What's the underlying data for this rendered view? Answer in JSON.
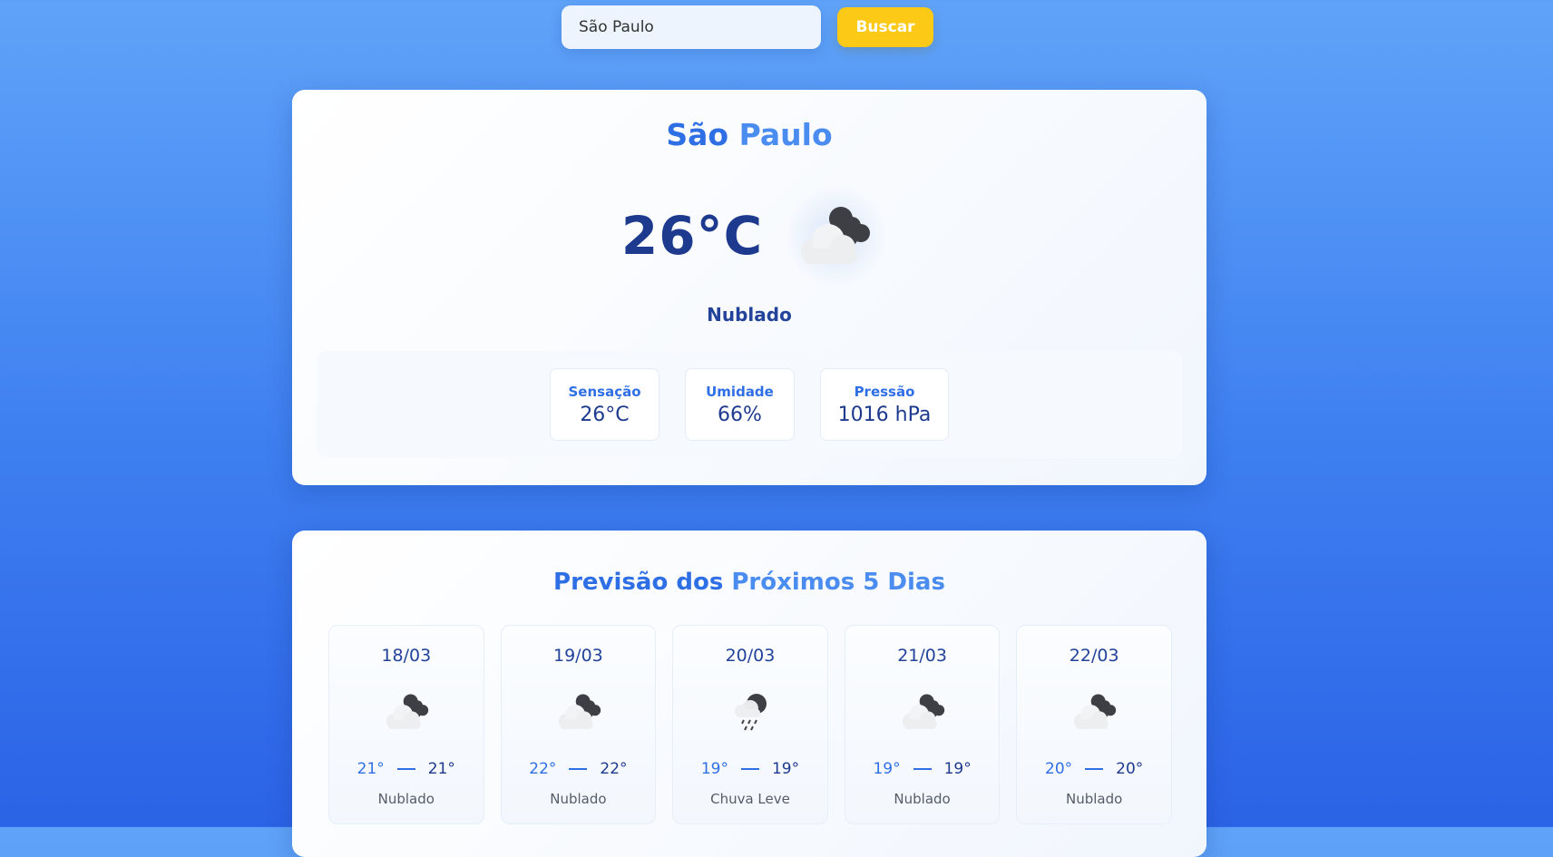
{
  "search": {
    "value": "São Paulo",
    "button_label": "Buscar"
  },
  "current": {
    "city_first": "São",
    "city_second": "Paulo",
    "temperature": "26°C",
    "icon": "cloudy-night-icon",
    "condition": "Nublado",
    "details": [
      {
        "label": "Sensação",
        "value": "26°C"
      },
      {
        "label": "Umidade",
        "value": "66%"
      },
      {
        "label": "Pressão",
        "value": "1016 hPa"
      }
    ]
  },
  "forecast": {
    "title_first": "Previsão dos",
    "title_second": "Próximos 5 Dias",
    "days": [
      {
        "date": "18/03",
        "min": "21°",
        "max": "21°",
        "desc": "Nublado",
        "icon": "cloudy-night-icon"
      },
      {
        "date": "19/03",
        "min": "22°",
        "max": "22°",
        "desc": "Nublado",
        "icon": "cloudy-night-icon"
      },
      {
        "date": "20/03",
        "min": "19°",
        "max": "19°",
        "desc": "Chuva Leve",
        "icon": "light-rain-icon"
      },
      {
        "date": "21/03",
        "min": "19°",
        "max": "19°",
        "desc": "Nublado",
        "icon": "cloudy-night-icon"
      },
      {
        "date": "22/03",
        "min": "20°",
        "max": "20°",
        "desc": "Nublado",
        "icon": "cloudy-night-icon"
      }
    ]
  },
  "colors": {
    "accent": "#2f6fe6",
    "button": "#fcc917",
    "dark_text": "#1d3a8e"
  }
}
